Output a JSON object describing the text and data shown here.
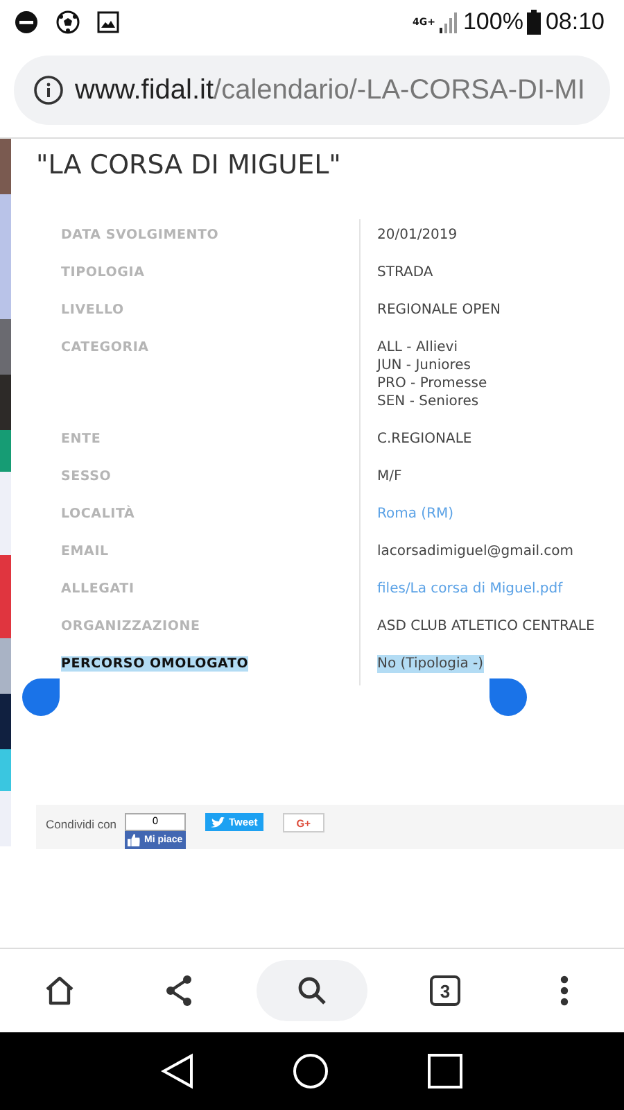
{
  "status_bar": {
    "network": "4G+",
    "battery": "100%",
    "time": "08:10"
  },
  "address_bar": {
    "domain": "www.fidal.it",
    "path": "/calendario/-LA-CORSA-DI-MI"
  },
  "title": "\"LA CORSA DI MIGUEL\"",
  "details": [
    {
      "label": "DATA SVOLGIMENTO",
      "kind": "text",
      "lines": [
        "20/01/2019"
      ],
      "selected": false
    },
    {
      "label": "TIPOLOGIA",
      "kind": "text",
      "lines": [
        "STRADA"
      ],
      "selected": false
    },
    {
      "label": "LIVELLO",
      "kind": "text",
      "lines": [
        "REGIONALE OPEN"
      ],
      "selected": false
    },
    {
      "label": "CATEGORIA",
      "kind": "text",
      "lines": [
        "ALL - Allievi",
        "JUN - Juniores",
        "PRO - Promesse",
        "SEN - Seniores"
      ],
      "selected": false
    },
    {
      "label": "ENTE",
      "kind": "text",
      "lines": [
        "C.REGIONALE"
      ],
      "selected": false
    },
    {
      "label": "SESSO",
      "kind": "text",
      "lines": [
        "M/F"
      ],
      "selected": false
    },
    {
      "label": "LOCALITÀ",
      "kind": "link",
      "lines": [
        "Roma (RM)"
      ],
      "selected": false
    },
    {
      "label": "EMAIL",
      "kind": "text",
      "lines": [
        "lacorsadimiguel@gmail.com"
      ],
      "selected": false
    },
    {
      "label": "ALLEGATI",
      "kind": "link",
      "lines": [
        "files/La corsa di Miguel.pdf"
      ],
      "selected": false
    },
    {
      "label": "ORGANIZZAZIONE",
      "kind": "text",
      "lines": [
        "ASD CLUB ATLETICO CENTRALE"
      ],
      "selected": false
    },
    {
      "label": "PERCORSO OMOLOGATO",
      "kind": "text",
      "lines": [
        "No (Tipologia -)"
      ],
      "selected": true
    }
  ],
  "share": {
    "label": "Condividi con",
    "like_count": "0",
    "like_label": "Mi piace",
    "tweet": "Tweet",
    "gplus": "G+"
  },
  "toolbar": {
    "tab_count": "3"
  }
}
